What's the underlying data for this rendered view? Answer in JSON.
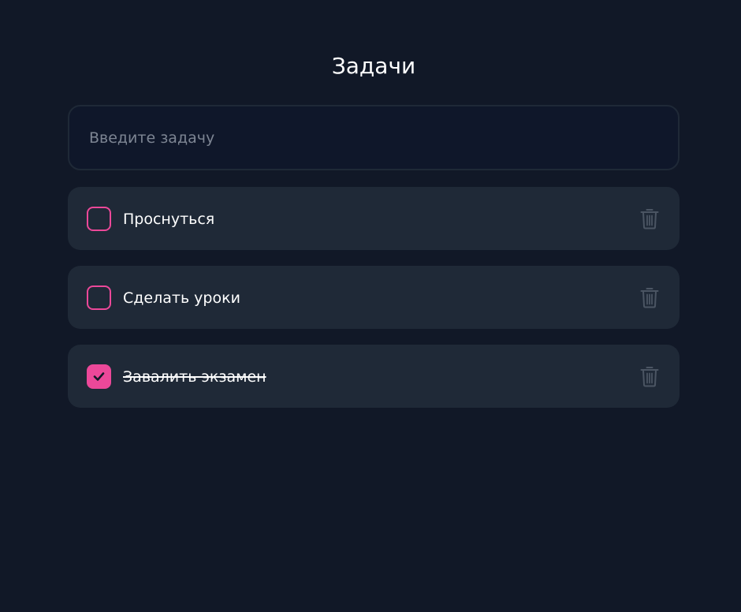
{
  "header": {
    "title": "Задачи"
  },
  "new_task": {
    "placeholder": "Введите задачу",
    "value": ""
  },
  "tasks": [
    {
      "label": "Проснуться",
      "completed": false
    },
    {
      "label": "Сделать уроки",
      "completed": false
    },
    {
      "label": "Завалить экзамен",
      "completed": true
    }
  ],
  "colors": {
    "background": "#111827",
    "card": "#1f2937",
    "accent": "#ec4899",
    "icon_muted": "#4b5563"
  },
  "icons": {
    "checkbox_checked": "check-icon",
    "delete": "trash-icon"
  }
}
